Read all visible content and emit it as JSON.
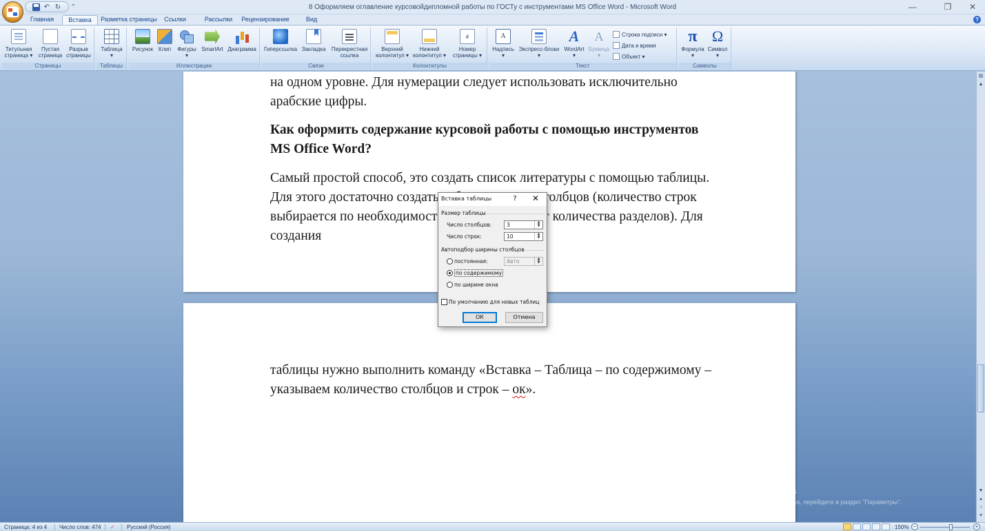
{
  "window": {
    "title": "8 Оформляем оглавление курсовойдипломной работы по ГОСТу с инструментами MS Office Word - Microsoft Word",
    "minimize": "—",
    "restore": "❐",
    "close": "✕"
  },
  "qat": {
    "undo": "↶",
    "redo": "↻",
    "more": "⁼"
  },
  "tabs": [
    "Главная",
    "Вставка",
    "Разметка страницы",
    "Ссылки",
    "Рассылки",
    "Рецензирование",
    "Вид"
  ],
  "active_tab": "Вставка",
  "ribbon": {
    "pages": {
      "label": "Страницы",
      "cover": "Титульная\nстраница ▾",
      "blank": "Пустая\nстраница",
      "break": "Разрыв\nстраницы"
    },
    "tables": {
      "label": "Таблицы",
      "table": "Таблица\n▾"
    },
    "illustrations": {
      "label": "Иллюстрации",
      "picture": "Рисунок",
      "clip": "Клип",
      "shapes": "Фигуры\n▾",
      "smartart": "SmartArt",
      "chart": "Диаграмма"
    },
    "links": {
      "label": "Связи",
      "hyperlink": "Гиперссылка",
      "bookmark": "Закладка",
      "crossref": "Перекрестная\nссылка"
    },
    "headerfooter": {
      "label": "Колонтитулы",
      "header": "Верхний\nколонтитул ▾",
      "footer": "Нижний\nколонтитул ▾",
      "pagenum": "Номер\nстраницы ▾",
      "pagenum_icon": "#"
    },
    "text": {
      "label": "Текст",
      "textbox": "Надпись\n▾",
      "textbox_icon": "A",
      "express": "Экспресс-блоки\n▾",
      "wordart": "WordArt\n▾",
      "wordart_icon": "A",
      "dropcap": "Буквица\n▾",
      "dropcap_icon": "A",
      "signature": "Строка подписи ▾",
      "datetime": "Дата и время",
      "object": "Объект ▾"
    },
    "symbols": {
      "label": "Символы",
      "formula": "Формула\n▾",
      "formula_icon": "π",
      "symbol": "Символ\n▾",
      "symbol_icon": "Ω"
    }
  },
  "document": {
    "p1_line1": "на одном уровне. Для нумерации следует использовать исключительно",
    "p1_line2": "арабские цифры.",
    "heading_line1": "Как оформить содержание курсовой работы с помощью инструментов",
    "heading_line2": "MS Office Word?",
    "p2_line1": "Самый простой способ, это создать список литературы с помощью таблицы.",
    "p2_line2": "Для этого достаточно создать таблицу из двух столбцов (количество строк",
    "p2_line3": "выбирается по необходимости, в зависимости от количества разделов). Для создания",
    "p3_line1": "таблицы нужно выполнить команду «Вставка – Таблица – по содержимому –",
    "p3_line2_a": "указываем количество столбцов и строк – ",
    "p3_line2_b": "ок",
    "p3_line2_c": "»."
  },
  "dialog": {
    "title": "Вставка таблицы",
    "help": "?",
    "close": "✕",
    "size_section": "Размер таблицы",
    "columns_label": "Число столбцов:",
    "columns_value": "3",
    "rows_label": "Число строк:",
    "rows_value": "10",
    "autofit_section": "Автоподбор ширины столбцов",
    "fixed_label": "постоянная:",
    "fixed_value": "Авто",
    "content_label": "по содержимому",
    "window_label": "по ширине окна",
    "default_label": "По умолчанию для новых таблиц",
    "ok": "ОК",
    "cancel": "Отмена"
  },
  "watermark": {
    "title": "Активация Windows",
    "subtitle": "Чтобы активировать Windows, перейдите в раздел \"Параметры\"."
  },
  "status": {
    "page": "Страница: 4 из 4",
    "words": "Число слов: 474",
    "language": "Русский (Россия)",
    "zoom": "150%",
    "zoom_out": "−",
    "zoom_in": "+"
  },
  "colors": {
    "accent": "#2b579a",
    "ribbon": "#dce8f6",
    "workspace": "#9cb8d7"
  }
}
